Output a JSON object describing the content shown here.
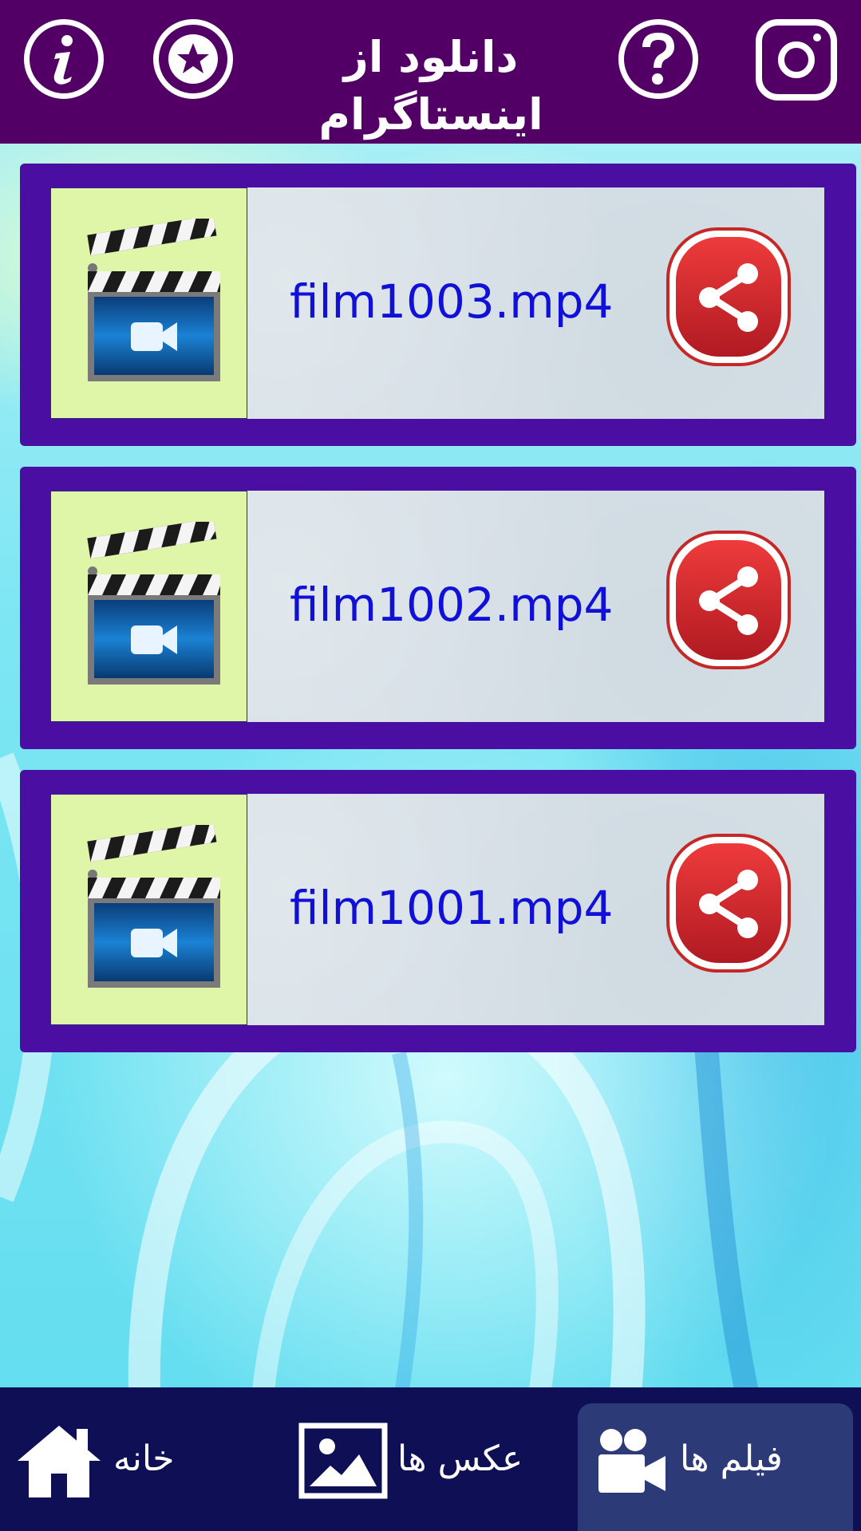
{
  "header": {
    "title": "دانلود از اینستاگرام",
    "info_icon": "info-icon",
    "rate_icon": "star-icon",
    "help_icon": "question-icon",
    "instagram_icon": "instagram-icon"
  },
  "files": [
    {
      "name": "film1003.mp4",
      "thumb_icon": "clapperboard-video-icon",
      "action_icon": "share-icon"
    },
    {
      "name": "film1002.mp4",
      "thumb_icon": "clapperboard-video-icon",
      "action_icon": "share-icon"
    },
    {
      "name": "film1001.mp4",
      "thumb_icon": "clapperboard-video-icon",
      "action_icon": "share-icon"
    }
  ],
  "bottom_nav": {
    "home_label": "خانه",
    "photos_label": "عکس ها",
    "videos_label": "فیلم ها",
    "active": "videos"
  },
  "colors": {
    "header_bg": "#520066",
    "card_border": "#4b0ea3",
    "file_text": "#1010d8",
    "nav_bg": "#0f0f55",
    "nav_active_bg": "#2d3a78",
    "share_red": "#d8232a"
  }
}
